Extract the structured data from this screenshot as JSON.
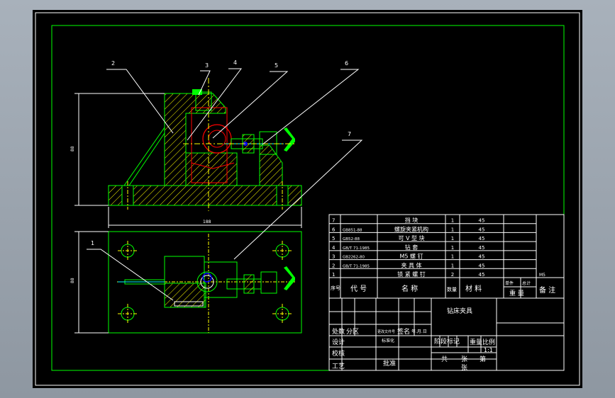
{
  "colors": {
    "background": "#000000",
    "frame": "#ffffff",
    "border": "#00ff00",
    "hatch": "#ffff00",
    "center_line": "#ffff00",
    "part": "#00ff00",
    "highlight": "#ff0000",
    "leader": "#ffffff",
    "bolt": "#00ffff",
    "accent": "#0000ff"
  },
  "balloons": [
    "2",
    "3",
    "4",
    "5",
    "6",
    "7",
    "1"
  ],
  "dimensions": {
    "height_label": "88",
    "width_label": "188",
    "depth_label": "88"
  },
  "parts_list": {
    "rows": [
      {
        "no": "7",
        "code": "",
        "name": "挡 块",
        "qty": "1",
        "material": "45",
        "note": ""
      },
      {
        "no": "6",
        "code": "GB851-88",
        "name": "螺旋夹紧机构",
        "qty": "1",
        "material": "45",
        "note": ""
      },
      {
        "no": "5",
        "code": "GB52-88",
        "name": "可 V 型 块",
        "qty": "1",
        "material": "45",
        "note": ""
      },
      {
        "no": "4",
        "code": "GB/T 71-1985",
        "name": "钻 套",
        "qty": "1",
        "material": "45",
        "note": ""
      },
      {
        "no": "3",
        "code": "GB2262-80",
        "name": "M5 螺 钉",
        "qty": "1",
        "material": "45",
        "note": ""
      },
      {
        "no": "2",
        "code": "GB/T 71-1985",
        "name": "夹 具 体",
        "qty": "1",
        "material": "45",
        "note": ""
      },
      {
        "no": "1",
        "code": "",
        "name": "锁 紧 螺 钉",
        "qty": "2",
        "material": "45",
        "note": "M5"
      }
    ],
    "header": {
      "no": "序号",
      "code": "代 号",
      "name": "名 称",
      "qty": "数量",
      "material": "材 料",
      "unit_weight": "单件",
      "total_weight": "总计",
      "weight": "重 量",
      "note": "备 注"
    }
  },
  "title_block": {
    "title": "钻床夹具",
    "labels": {
      "revision": "处数",
      "zone": "分区",
      "document": "更改文件号",
      "signature": "签名",
      "date": "年.月.日",
      "designer": "设计",
      "standardization": "标准化",
      "stage_mark": "阶段标记",
      "weight": "重量",
      "scale": "比例",
      "checker": "校核",
      "process": "工艺",
      "approval": "批准",
      "total_sheets": "共",
      "sheet": "张",
      "sheet_no": "第",
      "sheet2": "张"
    },
    "scale_value": "1:1"
  }
}
